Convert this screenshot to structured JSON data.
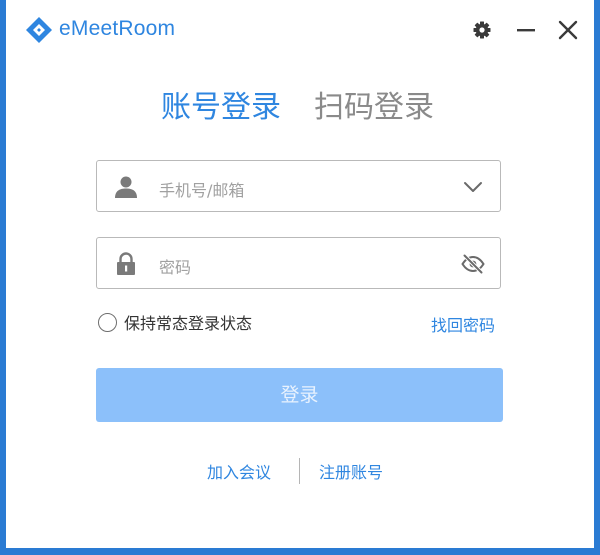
{
  "app": {
    "title": "eMeetRoom",
    "brand_color": "#2f86e0"
  },
  "titlebar": {
    "icons": [
      "gear-icon",
      "minimize-icon",
      "close-icon"
    ]
  },
  "tabs": [
    {
      "label": "账号登录",
      "active": true
    },
    {
      "label": "扫码登录",
      "active": false
    }
  ],
  "form": {
    "account": {
      "placeholder": "手机号/邮箱",
      "value": "",
      "icons": [
        "user-icon",
        "chevron-down-icon"
      ]
    },
    "password": {
      "placeholder": "密码",
      "value": "",
      "icons": [
        "lock-icon",
        "eye-off-icon"
      ]
    },
    "remember_label": "保持常态登录状态",
    "remember_checked": false,
    "forgot_label": "找回密码",
    "login_label": "登录",
    "login_color": "#8cc0fa"
  },
  "footer": {
    "join_label": "加入会议",
    "register_label": "注册账号"
  }
}
